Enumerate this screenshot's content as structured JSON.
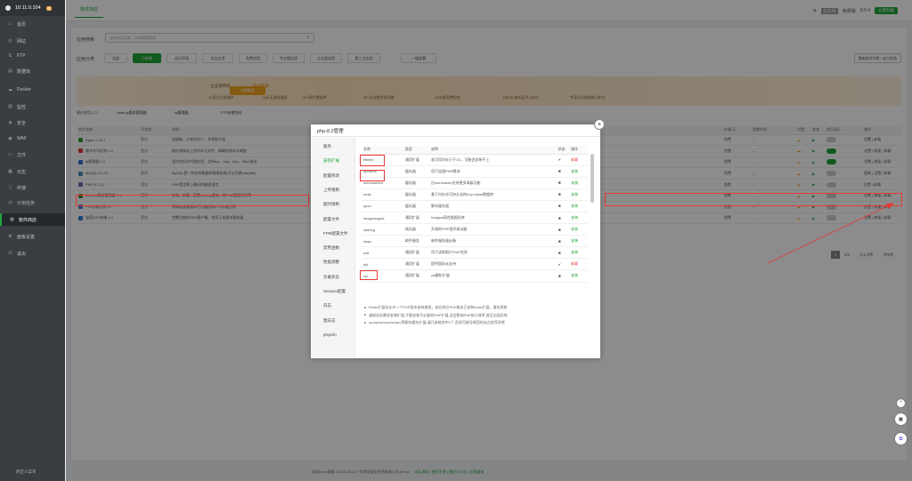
{
  "server": {
    "ip": "10.11.0.104",
    "badge": "0"
  },
  "sidebar": {
    "items": [
      {
        "label": "首页",
        "icon": "home-icon"
      },
      {
        "label": "网站",
        "icon": "globe-icon"
      },
      {
        "label": "FTP",
        "icon": "ftp-icon"
      },
      {
        "label": "数据库",
        "icon": "database-icon"
      },
      {
        "label": "Docker",
        "icon": "docker-icon"
      },
      {
        "label": "监控",
        "icon": "monitor-icon"
      },
      {
        "label": "安全",
        "icon": "shield-icon"
      },
      {
        "label": "WAF",
        "icon": "waf-icon"
      },
      {
        "label": "文件",
        "icon": "folder-icon"
      },
      {
        "label": "日志",
        "icon": "log-icon"
      },
      {
        "label": "终端",
        "icon": "terminal-icon"
      },
      {
        "label": "计划任务",
        "icon": "clock-icon"
      },
      {
        "label": "软件商店",
        "icon": "store-icon"
      },
      {
        "label": "面板设置",
        "icon": "settings-icon"
      },
      {
        "label": "退出",
        "icon": "logout-icon"
      }
    ],
    "footer": "阴定义菜单"
  },
  "topbar": {
    "tab": "软件商店",
    "badge_text": "企业版",
    "expiry_label": "免费版",
    "version": "8.0.4",
    "upgrade": "立即升级"
  },
  "search": {
    "label": "应用搜索",
    "placeholder": "支持应用名称、字段模糊搜索"
  },
  "categories": {
    "label": "应用分类",
    "items": [
      "全部",
      "已安装",
      "运行环境",
      "安全应用",
      "免费应用",
      "专业版应用",
      "企业版应用",
      "第三方应用",
      "一键部署"
    ],
    "update_button": "更新软件列表 / 支付状态"
  },
  "banner": {
    "enterprise_btn": "立即购买",
    "title1": "企业版特权",
    "title2": "在线客服",
    "features": [
      "12项企业版插件",
      "15天无理由退款",
      "30+款付费插件",
      "20+企业版专享功能",
      "1000条免费短信",
      "2张SSL商用证书 (年付)",
      "专享企业服务群 (年付)"
    ]
  },
  "recent": {
    "label": "最近使用入口",
    "items": [
      "Node.js版本管理器",
      "fq管理器",
      "FTP存储空间"
    ]
  },
  "applist": {
    "headers": [
      "软件名称",
      "开发商",
      "说明",
      "价格/天",
      "到期时间",
      "位置",
      "状态",
      "首页显示",
      "操作"
    ],
    "rows": [
      {
        "name": "Nginx 1.22.1",
        "dev": "官方",
        "desc": "轻量级、占有内存少，并发能力强",
        "price": "免费",
        "expire": "--",
        "op": "设置 | 卸载"
      },
      {
        "name": "微步木马检测 1.0",
        "dev": "官方",
        "desc": "能检测网站上传的木马文件，精确检测木马威胁",
        "price": "免费",
        "expire": "--",
        "op": "设置 | 修复 | 卸载"
      },
      {
        "name": "fq管理器 1.0",
        "dev": "官方",
        "desc": "强大的反向代理应用，支持tcp、udp、http、https协议",
        "price": "免费",
        "expire": "--",
        "op": "设置 | 修复 | 卸载"
      },
      {
        "name": "MySQL 8.0.34",
        "dev": "官方",
        "desc": "MySQL是一种关系数据库管理系统(可以切换mariadb)",
        "price": "免费",
        "expire": "--",
        "op": "更新 | 设置 | 卸载"
      },
      {
        "name": "PHP-8.2.13",
        "dev": "官方",
        "desc": "PHP是世界上最好的编程语言",
        "price": "免费",
        "expire": "--",
        "op": "设置 | 卸载"
      },
      {
        "name": "Node.js版本管理器 1.9",
        "dev": "官方",
        "desc": "安装、卸载、配置node.js版本，和PM2管理项目等",
        "price": "免费",
        "expire": "--",
        "op": "设置 | 修复 | 卸载"
      },
      {
        "name": "FTP存储空间 5.7",
        "dev": "官方",
        "desc": "将网站或数据库打包备份到FTP存储空间",
        "price": "免费",
        "expire": "--",
        "op": "设置 | 修复 | 卸载"
      },
      {
        "name": "宝塔SSH终端 1.0",
        "dev": "官方",
        "desc": "完整功能的SSH客户端，仅用于连接本服务器",
        "price": "免费",
        "expire": "--",
        "op": "设置 | 修复 | 卸载"
      }
    ],
    "pagination": {
      "page": "1",
      "total": "1/1",
      "range": "从1-8条",
      "count": "共8条"
    }
  },
  "modal": {
    "title": "php-8.2管理",
    "nav": [
      "服务",
      "安装扩展",
      "配置修改",
      "上传限制",
      "超时限制",
      "配置文件",
      "FPM配置文件",
      "禁用函数",
      "性能调整",
      "负载状态",
      "Session配置",
      "日志",
      "慢日志",
      "phpinfo"
    ],
    "ext_headers": [
      "名称",
      "类型",
      "说明",
      "状态",
      "操作"
    ],
    "extensions": [
      {
        "name": "fileinfo",
        "type": "通用扩展",
        "desc": "若可用内存小于1G，可能会安装不上",
        "status": "✔",
        "op": "卸载"
      },
      {
        "name": "opcache",
        "type": "缓存器",
        "desc": "用于加速PHP脚本!",
        "status": "✖",
        "op": "安装"
      },
      {
        "name": "memcached",
        "type": "缓存器",
        "desc": "比memcache支持更多高级功能",
        "status": "✖",
        "op": "安装"
      },
      {
        "name": "redis",
        "type": "缓存器",
        "desc": "基于内存亦可持久化的Key-Value数据库",
        "status": "✖",
        "op": "安装"
      },
      {
        "name": "apcu",
        "type": "缓存器",
        "desc": "脚本缓存器",
        "status": "✖",
        "op": "安装"
      },
      {
        "name": "imagemagick",
        "type": "通用扩展",
        "desc": "Imagick高性能图形库",
        "status": "✖",
        "op": "安装"
      },
      {
        "name": "xdebug",
        "type": "调试器",
        "desc": "开源的PHP程序调试器",
        "status": "✖",
        "op": "安装"
      },
      {
        "name": "imap",
        "type": "邮件服务",
        "desc": "邮件服务器必备",
        "status": "✖",
        "op": "安装"
      },
      {
        "name": "exif",
        "type": "通用扩展",
        "desc": "用于读取图片EXIF信息",
        "status": "✖",
        "op": "安装"
      },
      {
        "name": "intl",
        "type": "通用扩展",
        "desc": "提供国际化支持",
        "status": "✔",
        "op": "卸载"
      },
      {
        "name": "xsl",
        "type": "通用扩展",
        "desc": "xsl解析扩展",
        "status": "✖",
        "op": "安装"
      }
    ],
    "notes": [
      "Redis扩展仅允许一个PHP版本安装使用，若在其它PHP版本已安装redis扩展，请勿再装",
      "请按实际需求安装扩展,不要安装不必要的PHP扩展,这会影响PHP执行效率,甚至出现异常",
      "opcache/xcache/apc等脚本缓存扩展,请只安装其中1个,否则可能导致您的站点程序异常"
    ]
  },
  "footer": {
    "text": "宝塔Linux面板 ©2014-2023 广东堡塔安全技术有限公司 (bt.cn)",
    "links": [
      "论坛求助",
      "使用手册",
      "微信公众号",
      "正版查询"
    ]
  },
  "colors": {
    "accent": "#20a53a",
    "highlight": "#e53935",
    "sidebar": "#3a3d42"
  }
}
